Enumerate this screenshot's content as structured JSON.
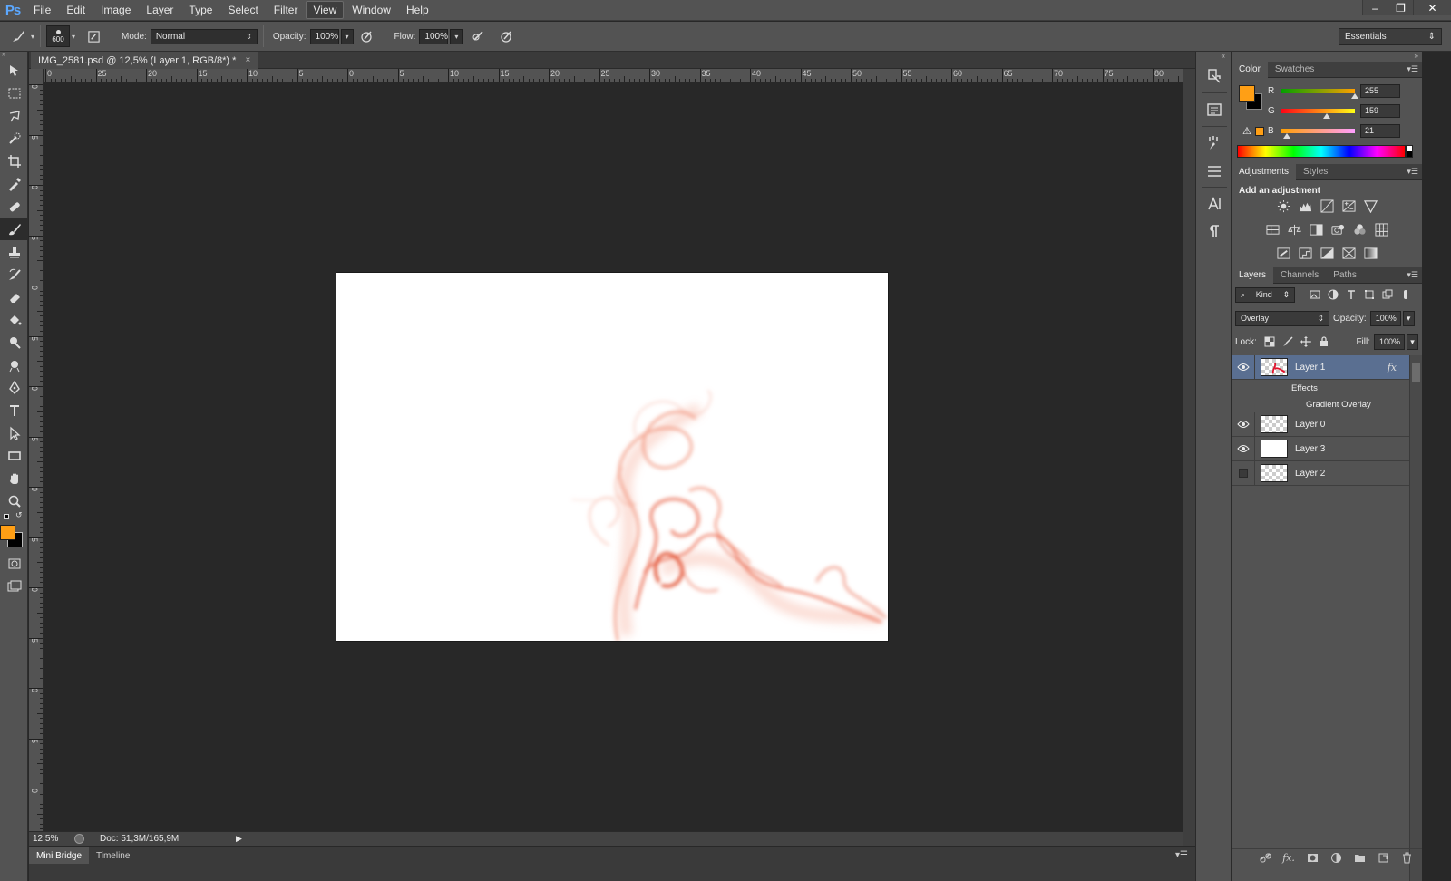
{
  "menubar": {
    "logo": "Ps",
    "items": [
      {
        "label": "File"
      },
      {
        "label": "Edit"
      },
      {
        "label": "Image"
      },
      {
        "label": "Layer"
      },
      {
        "label": "Type"
      },
      {
        "label": "Select"
      },
      {
        "label": "Filter"
      },
      {
        "label": "View"
      },
      {
        "label": "Window"
      },
      {
        "label": "Help"
      }
    ],
    "active": "View"
  },
  "options": {
    "brush_size": "600",
    "mode_label": "Mode:",
    "mode_value": "Normal",
    "opacity_label": "Opacity:",
    "opacity_value": "100%",
    "flow_label": "Flow:",
    "flow_value": "100%",
    "workspace": "Essentials"
  },
  "document": {
    "tab_title": "IMG_2581.psd @ 12,5% (Layer 1, RGB/8*) *",
    "close": "×",
    "ruler_h_labels": [
      "0",
      "25",
      "20",
      "15",
      "10",
      "5",
      "0",
      "5",
      "10",
      "15",
      "20",
      "25",
      "30",
      "35",
      "40",
      "45",
      "50",
      "55",
      "60",
      "65",
      "70",
      "75",
      "80"
    ],
    "ruler_v_labels": [
      "0",
      "5",
      "0",
      "5",
      "0",
      "5",
      "0",
      "5",
      "0",
      "5",
      "0",
      "5",
      "0",
      "5",
      "0",
      "5"
    ]
  },
  "status": {
    "zoom": "12,5%",
    "doc_size": "Doc: 51,3M/165,9M"
  },
  "bottom_tabs": {
    "mini_bridge": "Mini Bridge",
    "timeline": "Timeline"
  },
  "color_panel": {
    "tabs": {
      "color": "Color",
      "swatches": "Swatches"
    },
    "r_label": "R",
    "g_label": "G",
    "b_label": "B",
    "r": "255",
    "g": "159",
    "b": "21",
    "r_level": 1.0,
    "g_level": 0.62,
    "b_level": 0.08,
    "foreground": "#ff9f15",
    "background": "#000000"
  },
  "adjustments_panel": {
    "tabs": {
      "adjustments": "Adjustments",
      "styles": "Styles"
    },
    "title": "Add an adjustment"
  },
  "layers_panel": {
    "tabs": {
      "layers": "Layers",
      "channels": "Channels",
      "paths": "Paths"
    },
    "kind": "Kind",
    "blend_mode": "Overlay",
    "opacity_label": "Opacity:",
    "opacity": "100%",
    "lock_label": "Lock:",
    "fill_label": "Fill:",
    "fill": "100%",
    "fx": "fx",
    "layers": [
      {
        "name": "Layer 1",
        "visible": true,
        "selected": true
      },
      {
        "name": "Layer 0",
        "visible": true,
        "selected": false
      },
      {
        "name": "Layer 3",
        "visible": true,
        "selected": false
      },
      {
        "name": "Layer 2",
        "visible": false,
        "selected": false
      }
    ],
    "effects_label": "Effects",
    "effect_item": "Gradient Overlay"
  }
}
